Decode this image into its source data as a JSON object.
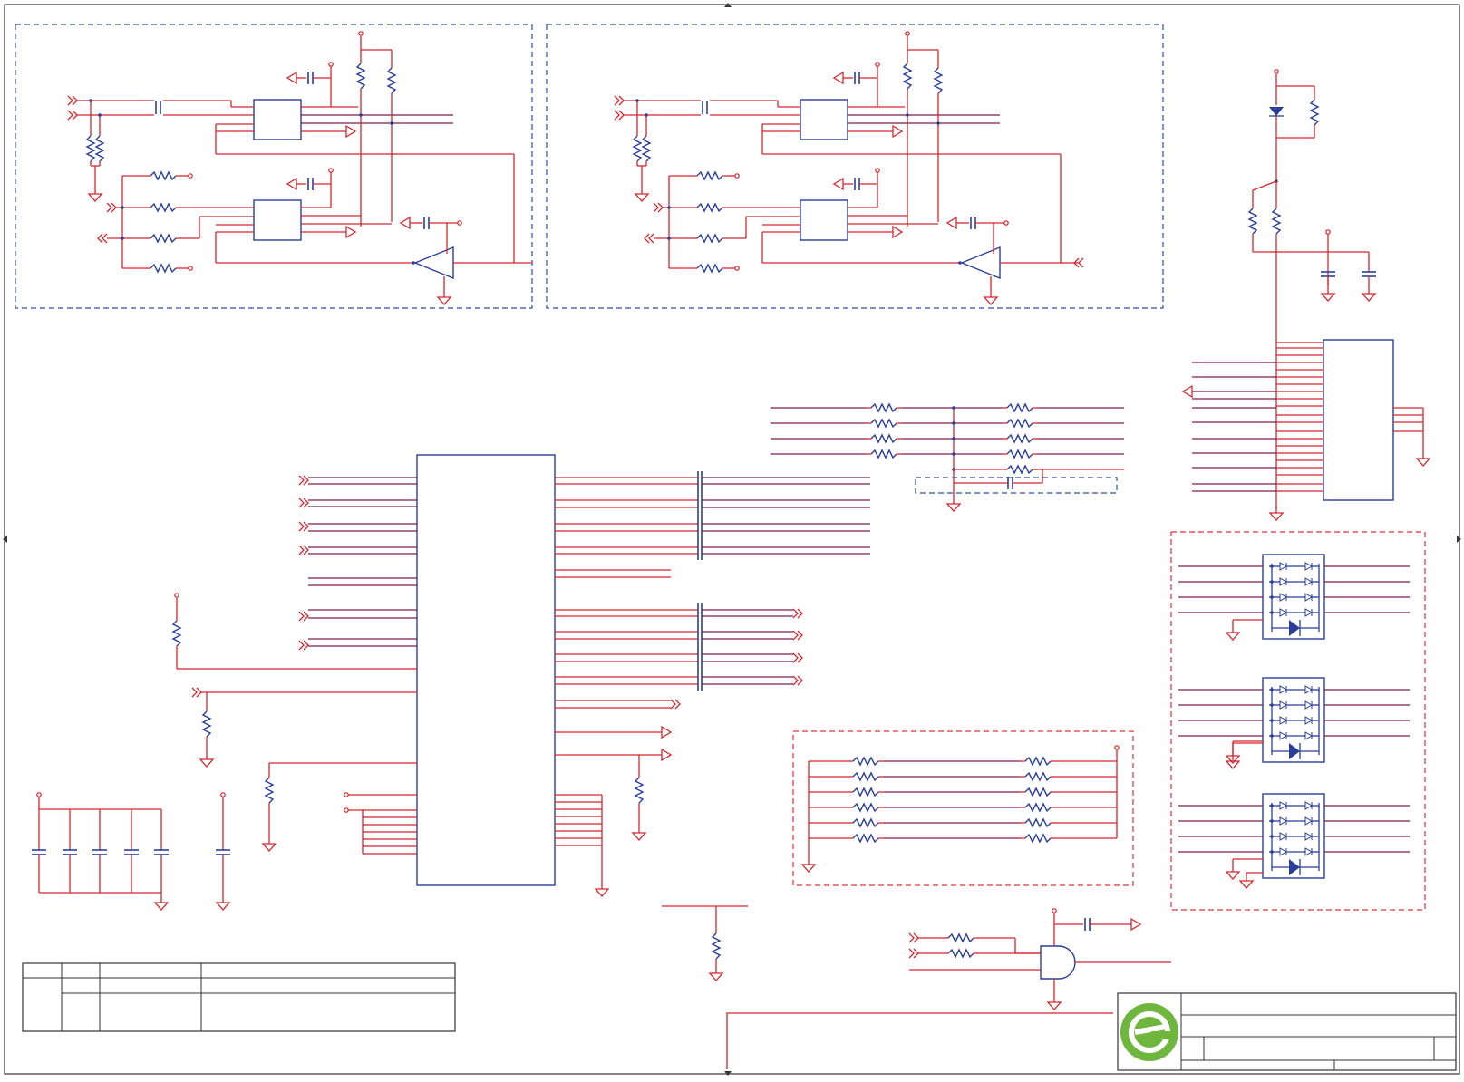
{
  "colors": {
    "wire": "#d7262e",
    "component": "#2a3f99",
    "net": "#7a1e4e",
    "dashed_blue": "#2e4fa0",
    "dashed_red": "#e0303a",
    "frame": "#333333",
    "logo_outer": "#6fb63e",
    "logo_inner": "#ffffff"
  },
  "logo_icon": "company-e-logo-icon"
}
